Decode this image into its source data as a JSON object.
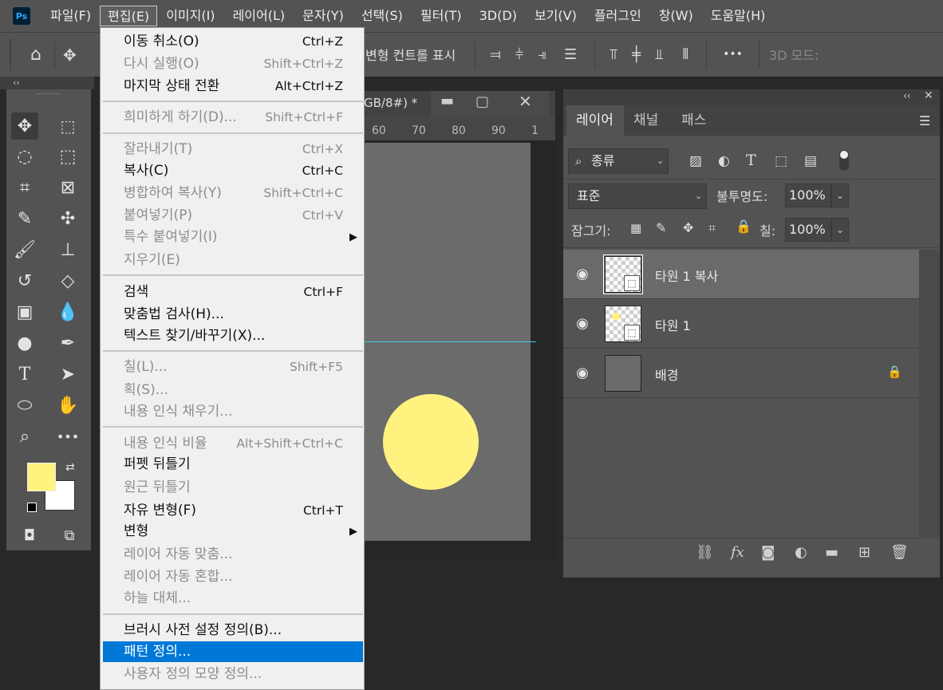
{
  "app": {
    "logo": "Ps"
  },
  "menubar": [
    {
      "label": "파일(F)"
    },
    {
      "label": "편집(E)"
    },
    {
      "label": "이미지(I)"
    },
    {
      "label": "레이어(L)"
    },
    {
      "label": "문자(Y)"
    },
    {
      "label": "선택(S)"
    },
    {
      "label": "필터(T)"
    },
    {
      "label": "3D(D)"
    },
    {
      "label": "보기(V)"
    },
    {
      "label": "플러그인"
    },
    {
      "label": "창(W)"
    },
    {
      "label": "도움말(H)"
    }
  ],
  "options": {
    "show_transform": "변형 컨트롤 표시",
    "mode_3d": "3D 모드:",
    "more": "•••"
  },
  "document": {
    "tab_title": "GB/8#) *",
    "ruler": [
      "60",
      "70",
      "80",
      "90",
      "1"
    ],
    "colors": {
      "fg": "#fff27f",
      "bg": "#ffffff",
      "canvas": "#6b6b6b",
      "guide": "#34d0e0"
    }
  },
  "edit_menu": {
    "items": [
      {
        "label": "이동 취소(O)",
        "shortcut": "Ctrl+Z",
        "enabled": true
      },
      {
        "label": "다시 실행(O)",
        "shortcut": "Shift+Ctrl+Z",
        "enabled": false
      },
      {
        "label": "마지막 상태 전환",
        "shortcut": "Alt+Ctrl+Z",
        "enabled": true
      },
      {
        "label": "희미하게 하기(D)...",
        "shortcut": "Shift+Ctrl+F",
        "enabled": false
      },
      {
        "label": "잘라내기(T)",
        "shortcut": "Ctrl+X",
        "enabled": false
      },
      {
        "label": "복사(C)",
        "shortcut": "Ctrl+C",
        "enabled": true
      },
      {
        "label": "병합하여 복사(Y)",
        "shortcut": "Shift+Ctrl+C",
        "enabled": false
      },
      {
        "label": "붙여넣기(P)",
        "shortcut": "Ctrl+V",
        "enabled": false
      },
      {
        "label": "특수 붙여넣기(I)",
        "shortcut": "",
        "enabled": false
      },
      {
        "label": "지우기(E)",
        "shortcut": "",
        "enabled": false
      },
      {
        "label": "검색",
        "shortcut": "Ctrl+F",
        "enabled": true
      },
      {
        "label": "맞춤법 검사(H)...",
        "shortcut": "",
        "enabled": true
      },
      {
        "label": "텍스트 찾기/바꾸기(X)...",
        "shortcut": "",
        "enabled": true
      },
      {
        "label": "칠(L)...",
        "shortcut": "Shift+F5",
        "enabled": false
      },
      {
        "label": "획(S)...",
        "shortcut": "",
        "enabled": false
      },
      {
        "label": "내용 인식 채우기...",
        "shortcut": "",
        "enabled": false
      },
      {
        "label": "내용 인식 비율",
        "shortcut": "Alt+Shift+Ctrl+C",
        "enabled": false
      },
      {
        "label": "퍼펫 뒤틀기",
        "shortcut": "",
        "enabled": true
      },
      {
        "label": "원근 뒤틀기",
        "shortcut": "",
        "enabled": false
      },
      {
        "label": "자유 변형(F)",
        "shortcut": "Ctrl+T",
        "enabled": true
      },
      {
        "label": "변형",
        "shortcut": "",
        "enabled": true
      },
      {
        "label": "레이어 자동 맞춤...",
        "shortcut": "",
        "enabled": false
      },
      {
        "label": "레이어 자동 혼합...",
        "shortcut": "",
        "enabled": false
      },
      {
        "label": "하늘 대체...",
        "shortcut": "",
        "enabled": false
      },
      {
        "label": "브러시 사전 설정 정의(B)...",
        "shortcut": "",
        "enabled": true
      },
      {
        "label": "패턴 정의...",
        "shortcut": "",
        "enabled": true,
        "highlighted": true
      },
      {
        "label": "사용자 정의 모양 정의...",
        "shortcut": "",
        "enabled": false
      }
    ]
  },
  "layers_panel": {
    "tabs": [
      "레이어",
      "채널",
      "패스"
    ],
    "filter_kind": "종류",
    "blend_mode": "표준",
    "opacity_label": "불투명도:",
    "opacity": "100%",
    "lock_label": "잠그기:",
    "fill_label": "칠:",
    "fill": "100%",
    "layers": [
      {
        "name": "타원 1 복사",
        "selected": true
      },
      {
        "name": "타원 1",
        "selected": false
      },
      {
        "name": "배경",
        "selected": false
      }
    ]
  }
}
